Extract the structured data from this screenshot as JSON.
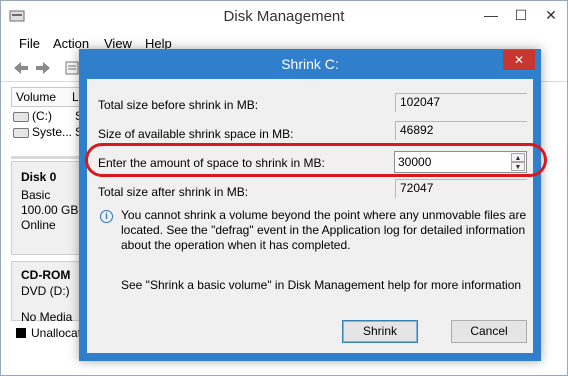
{
  "app": {
    "title": "Disk Management"
  },
  "window_controls": {
    "minimize": "—",
    "maximize": "☐",
    "close": "✕"
  },
  "menu": [
    "File",
    "Action",
    "View",
    "Help"
  ],
  "volume_list": {
    "header_volume": "Volume",
    "header_second": "L",
    "rows": [
      {
        "name": "(C:)",
        "trail": "S"
      },
      {
        "name": "Syste...",
        "trail": "S"
      }
    ]
  },
  "disks": [
    {
      "name": "Disk 0",
      "type": "Basic",
      "size": "100.00 GB",
      "status": "Online"
    },
    {
      "name": "CD-ROM",
      "type": "DVD (D:)",
      "status": "No Media"
    }
  ],
  "legend": {
    "unallocated": "Unallocat"
  },
  "dialog": {
    "title": "Shrink C:",
    "close_symbol": "✕",
    "fields": {
      "total_before_label": "Total size before shrink in MB:",
      "total_before_value": "102047",
      "available_label": "Size of available shrink space in MB:",
      "available_value": "46892",
      "amount_label": "Enter the amount of space to shrink in MB:",
      "amount_value": "30000",
      "total_after_label": "Total size after shrink in MB:",
      "total_after_value": "72047"
    },
    "info_text": "You cannot shrink a volume beyond the point where any unmovable files are located. See the \"defrag\" event in the Application log for detailed information about the operation when it has completed.",
    "help_text": "See \"Shrink a basic volume\" in Disk Management help for more information",
    "buttons": {
      "shrink": "Shrink",
      "cancel": "Cancel"
    }
  },
  "colors": {
    "dialog_frame": "#2f7fcc",
    "close_button": "#c7372f",
    "highlight_ring": "#d8191d"
  }
}
